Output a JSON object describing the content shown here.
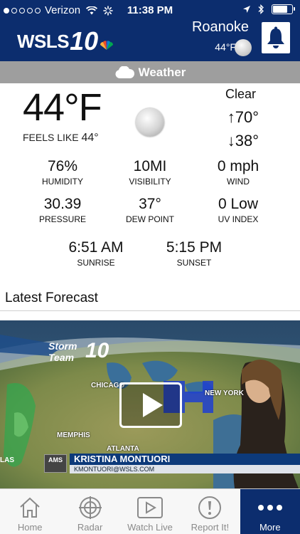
{
  "status_bar": {
    "carrier": "Verizon",
    "time": "11:38 PM",
    "battery_level": 0.75
  },
  "header": {
    "logo_text": "WSLS",
    "logo_number": "10",
    "city": "Roanoke",
    "temp": "44°F"
  },
  "weather_bar": {
    "label": "Weather"
  },
  "current": {
    "temp": "44°F",
    "feels_like_label": "FEELS LIKE",
    "feels_like_value": "44°",
    "condition": "Clear",
    "high": "↑70°",
    "low": "↓38°"
  },
  "stats": {
    "humidity": {
      "value": "76%",
      "label": "HUMIDITY"
    },
    "visibility": {
      "value": "10MI",
      "label": "VISIBILITY"
    },
    "wind": {
      "value": "0 mph",
      "label": "WIND"
    },
    "pressure": {
      "value": "30.39",
      "label": "PRESSURE"
    },
    "dew_point": {
      "value": "37°",
      "label": "DEW POINT"
    },
    "uv_index": {
      "value": "0 Low",
      "label": "UV INDEX"
    },
    "sunrise": {
      "value": "6:51 AM",
      "label": "SUNRISE"
    },
    "sunset": {
      "value": "5:15 PM",
      "label": "SUNSET"
    }
  },
  "forecast": {
    "title": "Latest Forecast",
    "video": {
      "brand_line1": "Storm",
      "brand_line2": "Team",
      "brand_number": "10",
      "map_labels": {
        "chicago": "CHICAGO",
        "new_york": "NEW YORK",
        "memphis": "MEMPHIS",
        "atlanta": "ATLANTA",
        "las": "LAS"
      },
      "badge": "AMS",
      "anchor_name": "KRISTINA MONTUORI",
      "anchor_email": "KMONTUORI@WSLS.COM"
    }
  },
  "tabs": [
    {
      "label": "Home",
      "icon": "home-icon"
    },
    {
      "label": "Radar",
      "icon": "radar-icon"
    },
    {
      "label": "Watch Live",
      "icon": "play-icon"
    },
    {
      "label": "Report It!",
      "icon": "alert-icon"
    },
    {
      "label": "More",
      "icon": "more-icon"
    }
  ],
  "colors": {
    "header_bg": "#0c2d6e",
    "weather_bar_bg": "#9e9e9e",
    "tab_active_bg": "#0c2d6e"
  }
}
